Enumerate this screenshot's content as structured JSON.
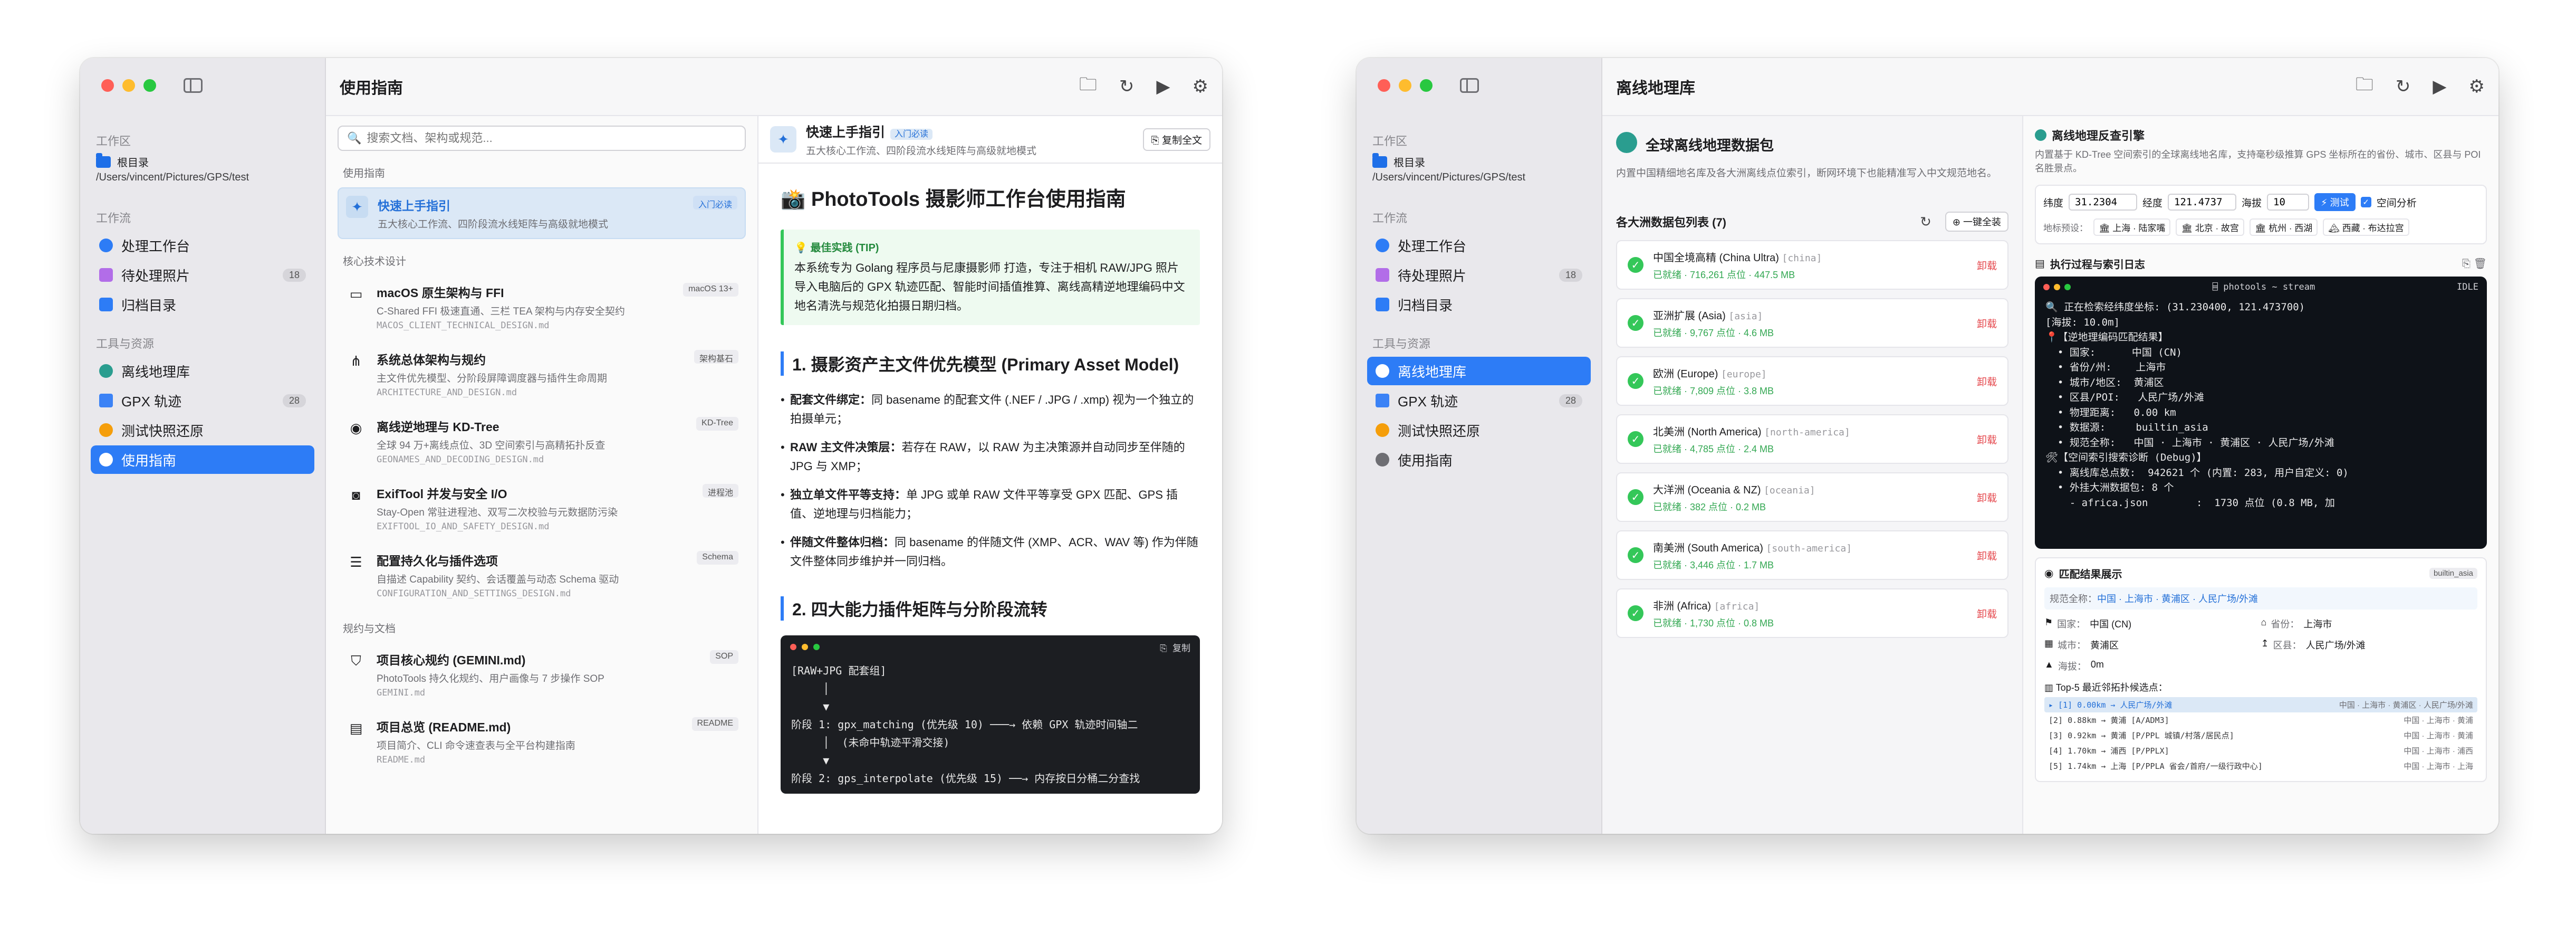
{
  "w1": {
    "title": "使用指南",
    "sidebar": {
      "workspace_label": "工作区",
      "root_label": "根目录",
      "root_path": "/Users/vincent/Pictures/GPS/test",
      "workflow_label": "工作流",
      "workflow_items": [
        {
          "label": "处理工作台",
          "badge": ""
        },
        {
          "label": "待处理照片",
          "badge": "18"
        },
        {
          "label": "归档目录",
          "badge": ""
        }
      ],
      "tools_label": "工具与资源",
      "tool_items": [
        {
          "label": "离线地理库",
          "badge": ""
        },
        {
          "label": "GPX 轨迹",
          "badge": "28"
        },
        {
          "label": "测试快照还原",
          "badge": ""
        },
        {
          "label": "使用指南",
          "badge": ""
        }
      ]
    },
    "search_placeholder": "搜索文档、架构或规范...",
    "list": {
      "sec1": "使用指南",
      "active": {
        "title": "快速上手指引",
        "desc": "五大核心工作流、四阶段流水线矩阵与高级就地模式",
        "badge": "入门必读"
      },
      "sec2": "核心技术设计",
      "core": [
        {
          "title": "macOS 原生架构与 FFI",
          "desc": "C-Shared FFI 极速直通、三栏 TEA 架构与内存安全契约",
          "file": "MACOS_CLIENT_TECHNICAL_DESIGN.md",
          "badge": "macOS 13+"
        },
        {
          "title": "系统总体架构与规约",
          "desc": "主文件优先模型、分阶段屏障调度器与插件生命周期",
          "file": "ARCHITECTURE_AND_DESIGN.md",
          "badge": "架构基石"
        },
        {
          "title": "离线逆地理与 KD-Tree",
          "desc": "全球 94 万+离线点位、3D 空间索引与高精拓扑反查",
          "file": "GEONAMES_AND_DECODING_DESIGN.md",
          "badge": "KD-Tree"
        },
        {
          "title": "ExifTool 并发与安全 I/O",
          "desc": "Stay-Open 常驻进程池、双写二次校验与元数据防污染",
          "file": "EXIFTOOL_IO_AND_SAFETY_DESIGN.md",
          "badge": "进程池"
        },
        {
          "title": "配置持久化与插件选项",
          "desc": "自描述 Capability 契约、会话覆盖与动态 Schema 驱动",
          "file": "CONFIGURATION_AND_SETTINGS_DESIGN.md",
          "badge": "Schema"
        }
      ],
      "sec3": "规约与文档",
      "specs": [
        {
          "title": "项目核心规约 (GEMINI.md)",
          "desc": "PhotoTools 持久化规约、用户画像与 7 步操作 SOP",
          "file": "GEMINI.md",
          "badge": "SOP"
        },
        {
          "title": "项目总览 (README.md)",
          "desc": "项目简介、CLI 命令速查表与全平台构建指南",
          "file": "README.md",
          "badge": "README"
        }
      ]
    },
    "doc": {
      "head_title": "快速上手指引",
      "head_badge": "入门必读",
      "head_sub": "五大核心工作流、四阶段流水线矩阵与高级就地模式",
      "copy": "复制全文",
      "h1": "📸 PhotoTools 摄影师工作台使用指南",
      "tip_title": "💡 最佳实践 (TIP)",
      "tip_body": "本系统专为 Golang 程序员与尼康摄影师 打造，专注于相机 RAW/JPG 照片导入电脑后的 GPX 轨迹匹配、智能时间插值推算、离线高精逆地理编码中文地名清洗与规范化拍摄日期归档。",
      "h2a": "1. 摄影资产主文件优先模型 (Primary Asset Model)",
      "bullets": [
        {
          "b": "配套文件绑定：",
          "t": "同 basename 的配套文件 (.NEF / .JPG / .xmp) 视为一个独立的拍摄单元；"
        },
        {
          "b": "RAW 主文件决策层：",
          "t": "若存在 RAW，以 RAW 为主决策源并自动同步至伴随的 JPG 与 XMP；"
        },
        {
          "b": "独立单文件平等支持：",
          "t": "单 JPG 或单 RAW 文件平等享受 GPX 匹配、GPS 插值、逆地理与归档能力；"
        },
        {
          "b": "伴随文件整体归档：",
          "t": "同 basename 的伴随文件 (XMP、ACR、WAV 等) 作为伴随文件整体同步维护并一同归档。"
        }
      ],
      "h2b": "2. 四大能力插件矩阵与分阶段流转",
      "code_copy": "复制",
      "code": "[RAW+JPG 配套组]\n     │\n     ▼\n阶段 1: gpx_matching (优先级 10) ───→ 依赖 GPX 轨迹时间轴二\n     │  (未命中轨迹平滑交接)\n     ▼\n阶段 2: gps_interpolate (优先级 15) ──→ 内存按日分桶二分查找"
    }
  },
  "w2": {
    "title": "离线地理库",
    "pkg": {
      "title": "全球离线地理数据包",
      "desc": "内置中国精细地名库及各大洲离线点位索引，断网环境下也能精准写入中文规范地名。",
      "list_title": "各大洲数据包列表 (7)",
      "install_all": "一键全装",
      "uninstall": "卸载",
      "regions": [
        {
          "name": "中国全境高精 (China Ultra)",
          "code": "[china]",
          "stat": "已就绪 · 716,261 点位 · 447.5 MB"
        },
        {
          "name": "亚洲扩展 (Asia)",
          "code": "[asia]",
          "stat": "已就绪 · 9,767 点位 · 4.6 MB"
        },
        {
          "name": "欧洲 (Europe)",
          "code": "[europe]",
          "stat": "已就绪 · 7,809 点位 · 3.8 MB"
        },
        {
          "name": "北美洲 (North America)",
          "code": "[north-america]",
          "stat": "已就绪 · 4,785 点位 · 2.4 MB"
        },
        {
          "name": "大洋洲 (Oceania & NZ)",
          "code": "[oceania]",
          "stat": "已就绪 · 382 点位 · 0.2 MB"
        },
        {
          "name": "南美洲 (South America)",
          "code": "[south-america]",
          "stat": "已就绪 · 3,446 点位 · 1.7 MB"
        },
        {
          "name": "非洲 (Africa)",
          "code": "[africa]",
          "stat": "已就绪 · 1,730 点位 · 0.8 MB"
        }
      ]
    },
    "engine": {
      "title": "离线地理反查引擎",
      "desc": "内置基于 KD-Tree 空间索引的全球离线地名库，支持毫秒级推算 GPS 坐标所在的省份、城市、区县与 POI 名胜景点。",
      "lat_label": "纬度",
      "lat": "31.2304",
      "lon_label": "经度",
      "lon": "121.4737",
      "alt_label": "海拔",
      "alt": "10",
      "test_btn": "⚡ 测试",
      "spatial_label": "空间分析",
      "preset_label": "地标预设：",
      "presets": [
        "🏛 上海 · 陆家嘴",
        "🏛 北京 · 故宫",
        "🏛 杭州 · 西湖",
        "🏔 西藏 · 布达拉宫"
      ],
      "log_title": "执行过程与索引日志",
      "term_title": "⌸ photools ~ stream",
      "term_idle": "IDLE",
      "term": "🔍 正在检索经纬度坐标: (31.230400, 121.473700)\n[海拔: 10.0m]\n📍【逆地理编码匹配结果】\n  • 国家:      中国 (CN)\n  • 省份/州:    上海市\n  • 城市/地区:  黄浦区\n  • 区县/POI:   人民广场/外滩\n  • 物理距离:   0.00 km\n  • 数据源:     builtin_asia\n  • 规范全称:   中国 · 上海市 · 黄浦区 · 人民广场/外滩\n🛠【空间索引搜索诊断 (Debug)】\n  • 离线库总点数:  942621 个 (内置: 283, 用户自定义: 0)\n  • 外挂大洲数据包: 8 个\n    - africa.json        :  1730 点位 (0.8 MB, 加",
      "result_title": "匹配结果展示",
      "result_badge": "builtin_asia",
      "full_label": "规范全称：",
      "full": "中国 · 上海市 · 黄浦区 · 人民广场/外滩",
      "country_label": "国家：",
      "country": "中国 (CN)",
      "province_label": "省份：",
      "province": "上海市",
      "city_label": "城市：",
      "city": "黄浦区",
      "district_label": "区县：",
      "district": "人民广场/外滩",
      "alt_res_label": "海拔：",
      "alt_res": "0m",
      "top5_title": "Top-5 最近邻拓扑候选点：",
      "top5": [
        {
          "l": "▸ [1]  0.00km → 人民广场/外滩",
          "r": "中国 · 上海市 · 黄浦区 · 人民广场/外滩"
        },
        {
          "l": "  [2]  0.88km → 黄浦 [A/ADM3]",
          "r": "中国 · 上海市 · 黄浦"
        },
        {
          "l": "  [3]  0.92km → 黄浦 [P/PPL 城镇/村落/居民点]",
          "r": "中国 · 上海市 · 黄浦"
        },
        {
          "l": "  [4]  1.70km → 浦西 [P/PPLX]",
          "r": "中国 · 上海市 · 浦西"
        },
        {
          "l": "  [5]  1.74km → 上海 [P/PPLA 省会/首府/一级行政中心]",
          "r": "中国 · 上海市 · 上海"
        }
      ]
    }
  }
}
